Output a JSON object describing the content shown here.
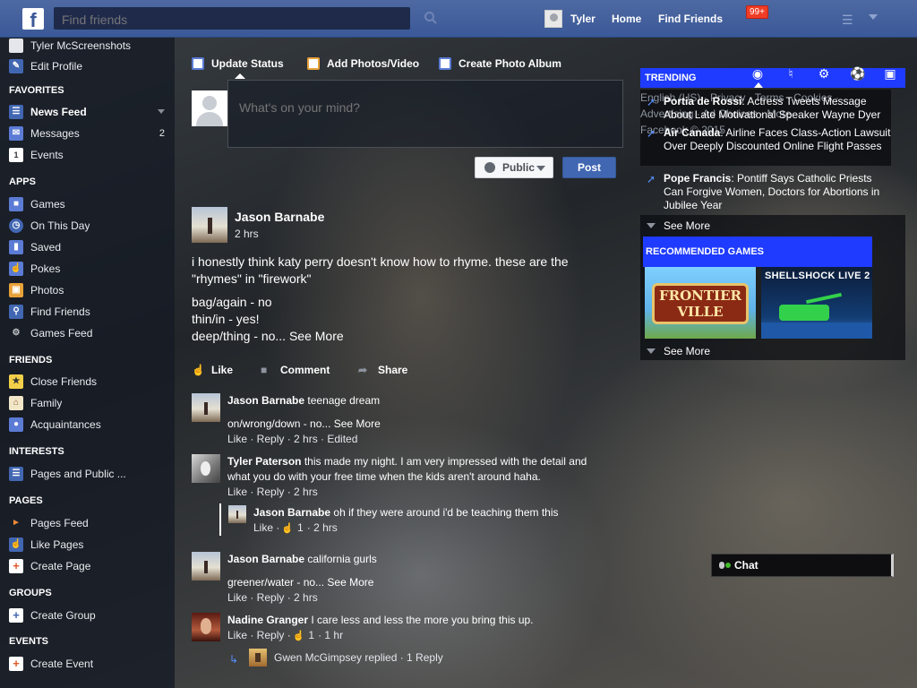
{
  "topbar": {
    "logo_letter": "f",
    "search_placeholder": "Find friends",
    "user_name": "Tyler",
    "home_label": "Home",
    "find_friends_label": "Find Friends",
    "notification_badge": "99+"
  },
  "sidebar": {
    "profile_name": "Tyler McScreenshots",
    "edit_profile": "Edit Profile",
    "favorites_head": "FAVORITES",
    "news_feed": "News Feed",
    "messages": "Messages",
    "messages_count": "2",
    "events": "Events",
    "events_day": "1",
    "apps_head": "APPS",
    "games": "Games",
    "on_this_day": "On This Day",
    "saved": "Saved",
    "pokes": "Pokes",
    "photos": "Photos",
    "find_friends": "Find Friends",
    "games_feed": "Games Feed",
    "friends_head": "FRIENDS",
    "close_friends": "Close Friends",
    "family": "Family",
    "acquaintances": "Acquaintances",
    "interests_head": "INTERESTS",
    "pages_public": "Pages and Public ...",
    "pages_head": "PAGES",
    "pages_feed": "Pages Feed",
    "like_pages": "Like Pages",
    "create_page": "Create Page",
    "groups_head": "GROUPS",
    "create_group": "Create Group",
    "events_head": "EVENTS",
    "create_event": "Create Event"
  },
  "composer": {
    "tab_status": "Update Status",
    "tab_photos": "Add Photos/Video",
    "tab_album": "Create Photo Album",
    "placeholder": "What's on your mind?",
    "audience": "Public",
    "post_label": "Post"
  },
  "post": {
    "author": "Jason Barnabe",
    "time": "2 hrs",
    "line1": "i honestly think katy perry doesn't know how to rhyme. these are the",
    "line2": "\"rhymes\" in \"firework\"",
    "line3": "bag/again - no",
    "line4": "thin/in - yes!",
    "line5": "deep/thing - no...",
    "see_more": "See More",
    "like": "Like",
    "comment": "Comment",
    "share": "Share"
  },
  "comments": [
    {
      "name": "Jason Barnabe",
      "text": "teenage dream",
      "text2": "on/wrong/down - no...",
      "see_more": "See More",
      "meta": "Like · Reply · 2 hrs · Edited"
    },
    {
      "name": "Tyler Paterson",
      "text": "this made my night. I am very impressed with the detail and",
      "text2": "what you do with your free time when the kids aren't around haha.",
      "meta": "Like · Reply · 2 hrs"
    },
    {
      "name": "Jason Barnabe",
      "text": "oh if they were around i'd be teaching them this",
      "meta_pre": "Like ·",
      "likes": "1",
      "meta_post": "· 2 hrs"
    },
    {
      "name": "Jason Barnabe",
      "text": "california gurls",
      "text2": "greener/water - no...",
      "see_more": "See More",
      "meta": "Like · Reply · 2 hrs"
    },
    {
      "name": "Nadine Granger",
      "text": "I care less and less the more you bring this up.",
      "meta_pre": "Like · Reply ·",
      "likes": "1",
      "meta_post": "· 1 hr"
    },
    {
      "reply_summary": "Gwen McGimpsey replied · 1 Reply"
    }
  ],
  "trending": {
    "head": "TRENDING",
    "ghost_line1": "English (US) · Privacy · Terms · Cookies ·",
    "ghost_line2": "Advertising · Ad Choices · More",
    "ghost_line3": "Facebook © 2015",
    "items": [
      {
        "name": "Portia de Rossi",
        "text": ": Actress Tweets Message About Late Motivational Speaker Wayne Dyer"
      },
      {
        "name": "Air Canada",
        "text": ": Airline Faces Class-Action Lawsuit Over Deeply Discounted Online Flight Passes"
      },
      {
        "name": "Pope Francis",
        "text": ": Pontiff Says Catholic Priests Can Forgive Women, Doctors for Abortions in Jubilee Year"
      }
    ],
    "see_more": "See More"
  },
  "games": {
    "head": "RECOMMENDED GAMES",
    "frontier_title": "FRONTIER VILLE",
    "shellshock_title": "SHELLSHOCK LIVE 2",
    "see_more": "See More"
  },
  "chat": {
    "label": "Chat"
  },
  "colors": {
    "facebook_blue": "#3b5998",
    "highlight_blue": "#1f3bff",
    "badge_red": "#f03d25",
    "like_blue": "#5890ff"
  }
}
